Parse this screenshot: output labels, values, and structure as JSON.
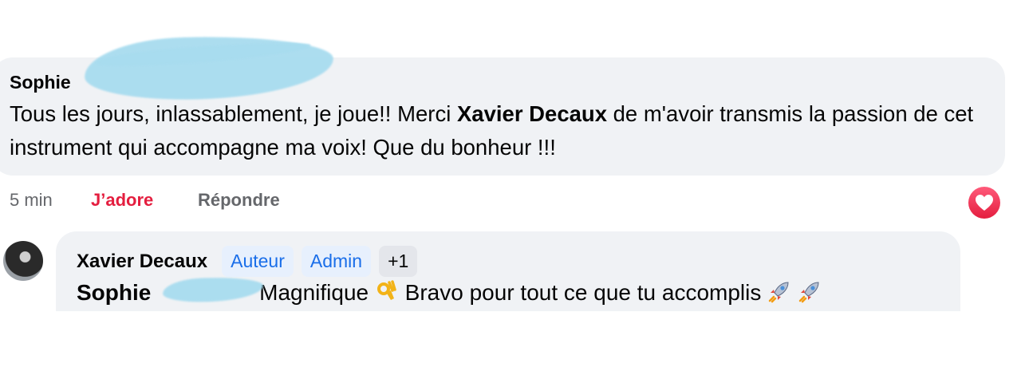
{
  "comment": {
    "author": "Sophie",
    "text_before": "Tous les jours, inlassablement, je joue!! Merci ",
    "mention": "Xavier Decaux",
    "text_after": " de m'avoir transmis la passion de cet instrument qui accompagne ma voix! Que du bonheur !!!",
    "time": "5 min",
    "reaction_label": "J’adore",
    "reply_label": "Répondre",
    "reaction_icon": "heart-icon"
  },
  "reply": {
    "author": "Xavier Decaux",
    "badges": [
      "Auteur",
      "Admin",
      "+1"
    ],
    "mention": "Sophie",
    "text": "Magnifique",
    "text2": "Bravo pour tout ce que tu accomplis",
    "emojis": [
      "ok-hand-icon",
      "rocket-icon",
      "rocket-icon"
    ]
  },
  "colors": {
    "bubble": "#f0f2f5",
    "reaction": "#e41e3f",
    "badge_bg": "#e7f0fd",
    "badge_text": "#1a6ee9",
    "redaction": "#a8dcef"
  }
}
